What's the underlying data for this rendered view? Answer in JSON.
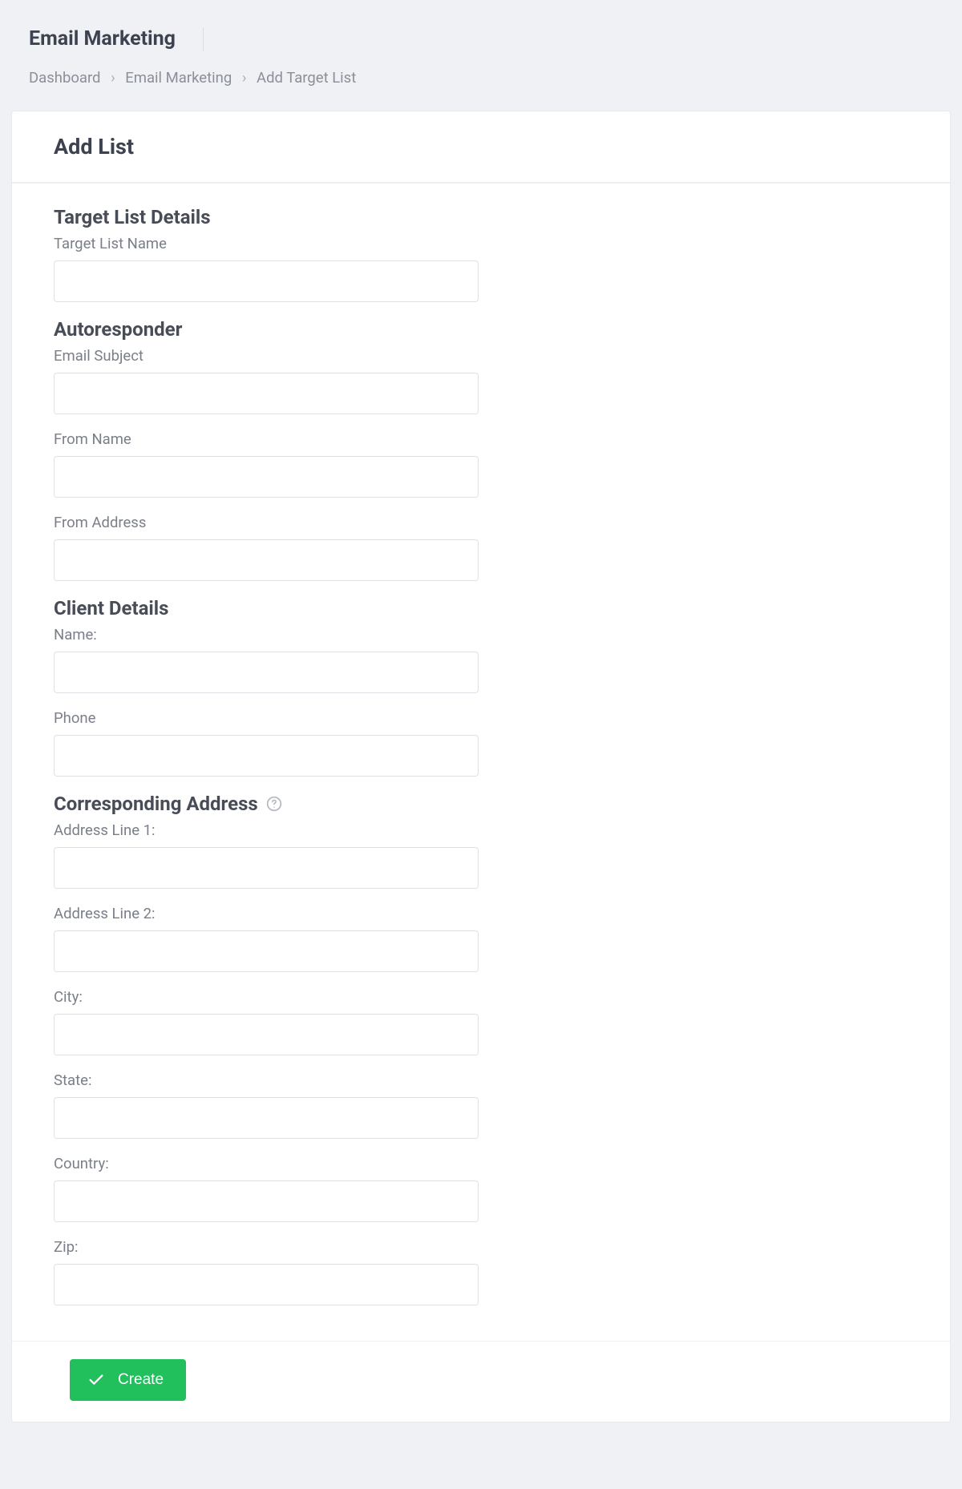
{
  "header": {
    "title": "Email Marketing",
    "breadcrumb": {
      "items": [
        "Dashboard",
        "Email Marketing",
        "Add Target List"
      ]
    }
  },
  "card": {
    "title": "Add List"
  },
  "sections": {
    "target_list": {
      "title": "Target List Details",
      "fields": {
        "name": {
          "label": "Target List Name"
        }
      }
    },
    "autoresponder": {
      "title": "Autoresponder",
      "fields": {
        "email_subject": {
          "label": "Email Subject"
        },
        "from_name": {
          "label": "From Name"
        },
        "from_address": {
          "label": "From Address"
        }
      }
    },
    "client_details": {
      "title": "Client Details",
      "fields": {
        "name": {
          "label": "Name:"
        },
        "phone": {
          "label": "Phone"
        }
      }
    },
    "corresponding_address": {
      "title": "Corresponding Address",
      "fields": {
        "address1": {
          "label": "Address Line 1:"
        },
        "address2": {
          "label": "Address Line 2:"
        },
        "city": {
          "label": "City:"
        },
        "state": {
          "label": "State:"
        },
        "country": {
          "label": "Country:"
        },
        "zip": {
          "label": "Zip:"
        }
      }
    }
  },
  "actions": {
    "create": "Create"
  }
}
